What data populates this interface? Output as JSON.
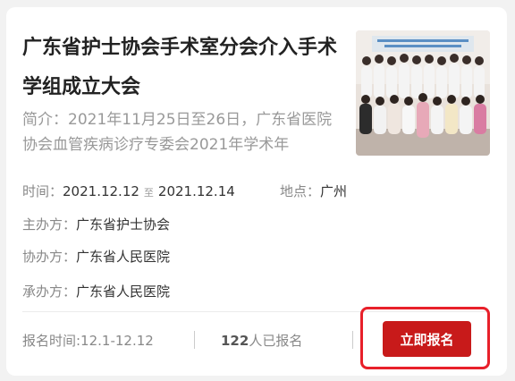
{
  "event": {
    "title": "广东省护士协会手术室分会介入手术学组成立大会",
    "summary": "简介：2021年11月25日至26日，广东省医院协会血管疾病诊疗专委会2021年学术年",
    "time_label": "时间：",
    "time_start": "2021.12.12",
    "time_separator": "至",
    "time_end": "2021.12.14",
    "location_label": "地点：",
    "location": "广州",
    "host_label": "主办方：",
    "host": "广东省护士协会",
    "cohost_label": "协办方：",
    "cohost": "广东省人民医院",
    "organizer_label": "承办方：",
    "organizer": "广东省人民医院"
  },
  "footer": {
    "registration_period": "报名时间:12.1-12.12",
    "registered_count": "122",
    "registered_suffix": "人已报名",
    "register_button": "立即报名"
  },
  "colors": {
    "accent": "#c81a1a",
    "highlight_border": "#e8202a"
  },
  "image": {
    "kind": "group-photo",
    "banner_text_unreadable": true
  }
}
